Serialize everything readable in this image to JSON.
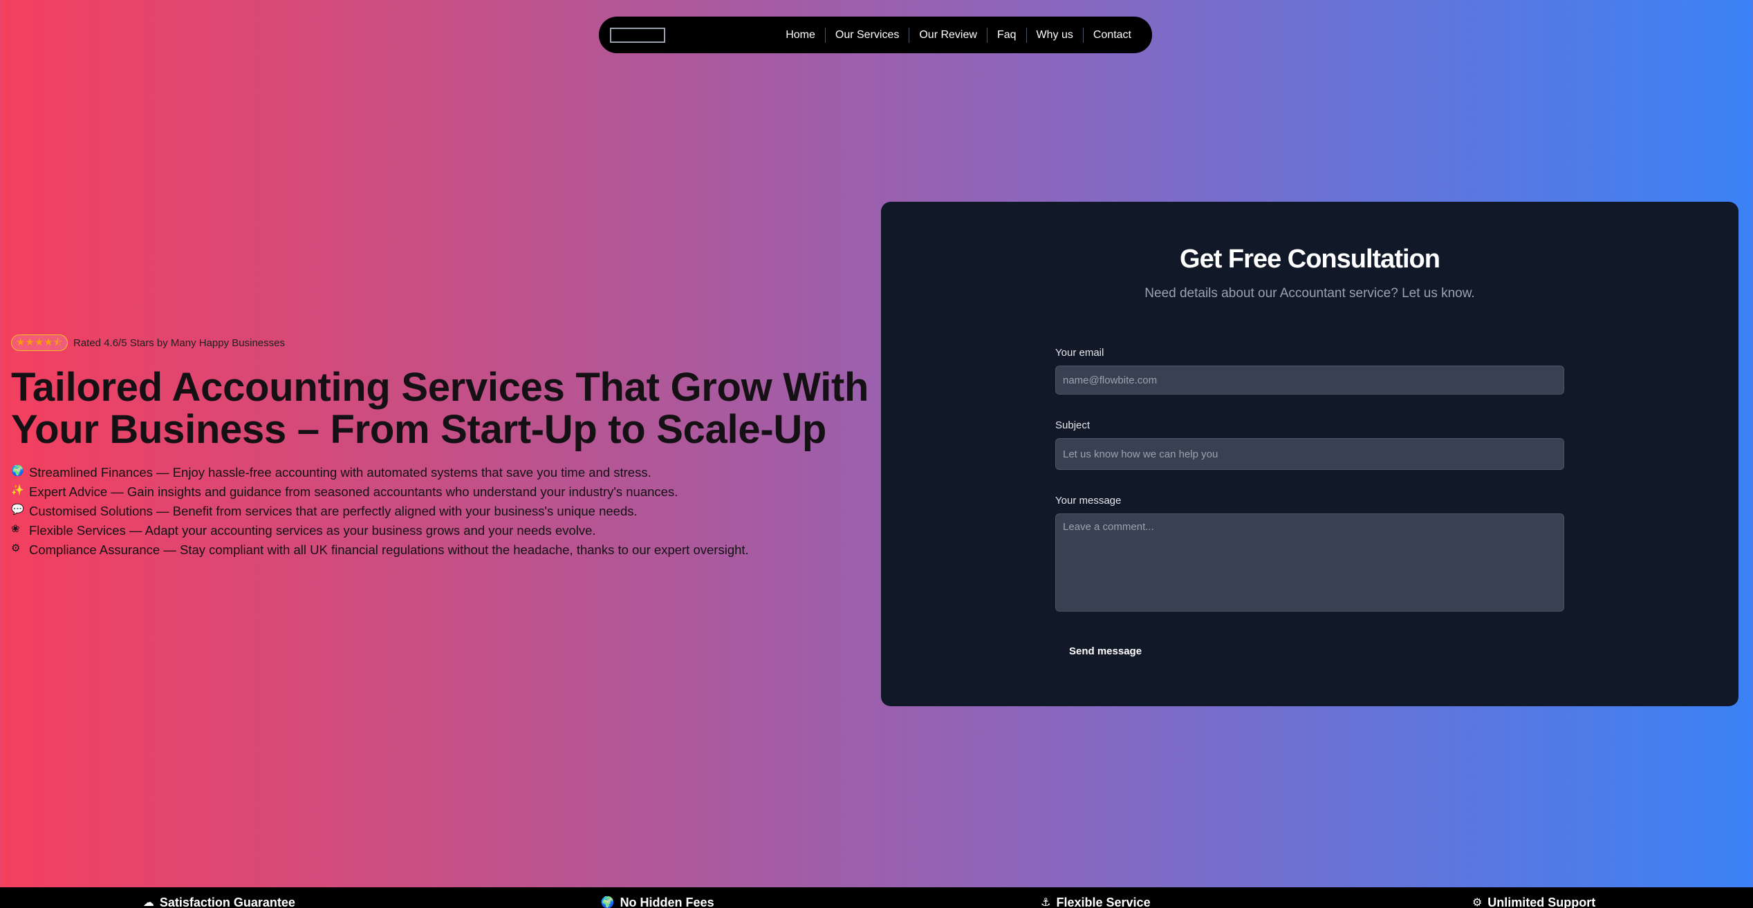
{
  "nav": {
    "logo": "logo",
    "links": [
      "Home",
      "Our Services",
      "Our Review",
      "Faq",
      "Why us",
      "Contact"
    ]
  },
  "hero": {
    "stars": "★★★★⯪",
    "rating_value": 4.6,
    "rating_text": "Rated 4.6/5 Stars by Many Happy Businesses",
    "headline_line1": "Tailored Accounting Services That Grow With",
    "headline_line2": "Your Business – From Start-Up to Scale-Up",
    "features": [
      {
        "icon": "globe-icon",
        "glyph": "🌍",
        "text": "Streamlined Finances — Enjoy hassle-free accounting with automated systems that save you time and stress."
      },
      {
        "icon": "sparkle-icon",
        "glyph": "✨",
        "text": "Expert Advice — Gain insights and guidance from seasoned accountants who understand your industry's nuances."
      },
      {
        "icon": "chat-icon",
        "glyph": "💬",
        "text": "Customised Solutions — Benefit from services that are perfectly aligned with your business's unique needs."
      },
      {
        "icon": "flower-icon",
        "glyph": "❀",
        "text": "Flexible Services — Adapt your accounting services as your business grows and your needs evolve."
      },
      {
        "icon": "gear-icon",
        "glyph": "⚙",
        "text": "Compliance Assurance — Stay compliant with all UK financial regulations without the headache, thanks to our expert oversight."
      }
    ]
  },
  "form": {
    "title": "Get Free Consultation",
    "subtitle": "Need details about our Accountant service? Let us know.",
    "email_label": "Your email",
    "email_placeholder": "name@flowbite.com",
    "subject_label": "Subject",
    "subject_placeholder": "Let us know how we can help you",
    "message_label": "Your message",
    "message_placeholder": "Leave a comment...",
    "send_label": "Send message"
  },
  "bottom_bar": [
    {
      "icon": "cloud-icon",
      "glyph": "☁",
      "label": "Satisfaction Guarantee"
    },
    {
      "icon": "globe-icon",
      "glyph": "🌍",
      "label": "No Hidden Fees"
    },
    {
      "icon": "anchor-icon",
      "glyph": "⚓",
      "label": "Flexible Service"
    },
    {
      "icon": "gear-icon",
      "glyph": "⚙",
      "label": "Unlimited Support"
    }
  ],
  "colors": {
    "gradient_start": "#f43f5e",
    "gradient_end": "#3b82f6",
    "card_bg": "#111827",
    "input_bg": "#374151",
    "star": "#f59e0b"
  }
}
